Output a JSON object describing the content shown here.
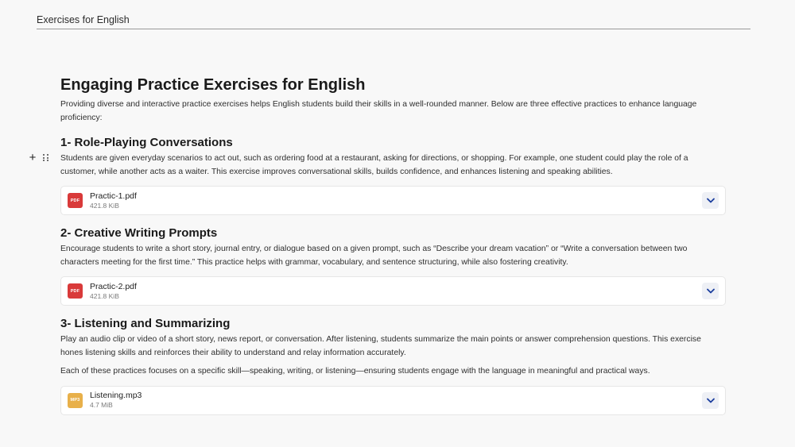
{
  "topbar": {
    "title": "Exercises for English"
  },
  "doc": {
    "title": "Engaging Practice Exercises for English",
    "intro": "Providing diverse and interactive practice exercises helps English students build their skills in a well-rounded manner. Below are three effective practices to enhance language proficiency:"
  },
  "sections": [
    {
      "title": "1- Role-Playing Conversations",
      "text": "Students are given everyday scenarios to act out, such as ordering food at a restaurant, asking for directions, or shopping. For example, one student could play the role of a customer, while another acts as a waiter. This exercise improves conversational skills, builds confidence, and enhances listening and speaking abilities.",
      "file": {
        "name": "Practic-1.pdf",
        "size": "421.8 KiB",
        "type": "PDF",
        "color": "#d93a3a"
      }
    },
    {
      "title": "2- Creative Writing Prompts",
      "text": "Encourage students to write a short story, journal entry, or dialogue based on a given prompt, such as “Describe your dream vacation” or “Write a conversation between two characters meeting for the first time.” This practice helps with grammar, vocabulary, and sentence structuring, while also fostering creativity.",
      "file": {
        "name": "Practic-2.pdf",
        "size": "421.8 KiB",
        "type": "PDF",
        "color": "#d93a3a"
      }
    },
    {
      "title": "3- Listening and Summarizing",
      "text": "Play an audio clip or video of a short story, news report, or conversation. After listening, students summarize the main points or answer comprehension questions. This exercise hones listening skills and reinforces their ability to understand and relay information accurately.",
      "extra": "Each of these practices focuses on a specific skill—speaking, writing, or listening—ensuring students engage with the language in meaningful and practical ways.",
      "file": {
        "name": "Listening.mp3",
        "size": "4.7 MiB",
        "type": "MP3",
        "color": "#e8b04a"
      }
    }
  ],
  "icons": {
    "add": "plus-icon",
    "drag": "drag-handle-icon",
    "expand": "chevron-down-icon"
  },
  "colors": {
    "accent": "#1a3d9e",
    "pdf": "#d93a3a",
    "mp3": "#e8b04a"
  }
}
